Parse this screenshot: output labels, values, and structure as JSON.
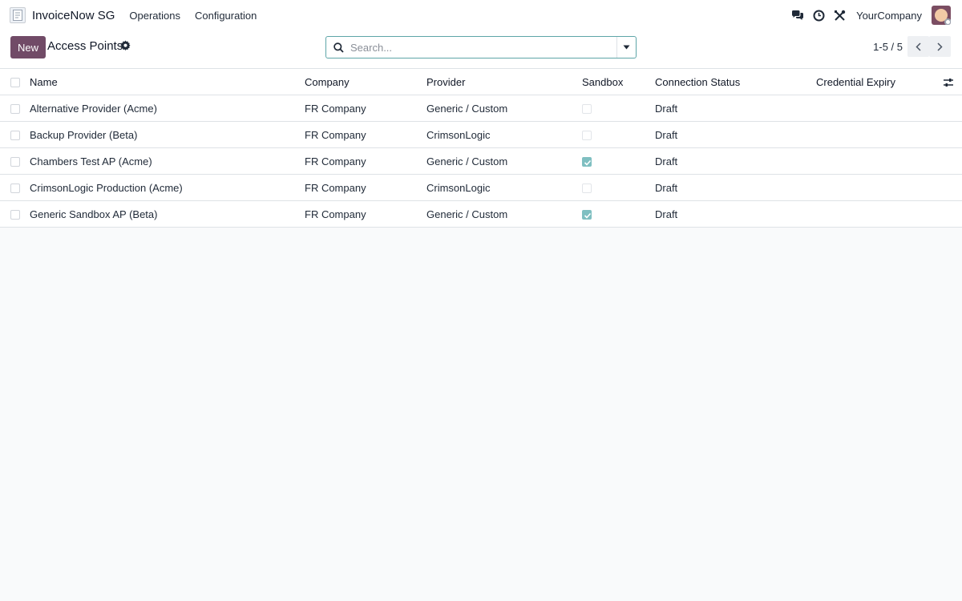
{
  "navbar": {
    "app_name": "InvoiceNow SG",
    "menus": [
      "Operations",
      "Configuration"
    ],
    "company": "YourCompany",
    "icons": [
      "chat-icon",
      "clock-icon",
      "tools-icon"
    ]
  },
  "control": {
    "new_label": "New",
    "title": "Access Points",
    "search_placeholder": "Search...",
    "pager": "1-5 / 5"
  },
  "table": {
    "columns": {
      "name": "Name",
      "company": "Company",
      "provider": "Provider",
      "sandbox": "Sandbox",
      "status": "Connection Status",
      "expiry": "Credential Expiry"
    },
    "rows": [
      {
        "name": "Alternative Provider (Acme)",
        "company": "FR Company",
        "provider": "Generic / Custom",
        "sandbox": false,
        "status": "Draft",
        "expiry": ""
      },
      {
        "name": "Backup Provider (Beta)",
        "company": "FR Company",
        "provider": "CrimsonLogic",
        "sandbox": false,
        "status": "Draft",
        "expiry": ""
      },
      {
        "name": "Chambers Test AP (Acme)",
        "company": "FR Company",
        "provider": "Generic / Custom",
        "sandbox": true,
        "status": "Draft",
        "expiry": ""
      },
      {
        "name": "CrimsonLogic Production (Acme)",
        "company": "FR Company",
        "provider": "CrimsonLogic",
        "sandbox": false,
        "status": "Draft",
        "expiry": ""
      },
      {
        "name": "Generic Sandbox AP (Beta)",
        "company": "FR Company",
        "provider": "Generic / Custom",
        "sandbox": true,
        "status": "Draft",
        "expiry": ""
      }
    ]
  },
  "colors": {
    "primary": "#714b67",
    "accent": "#7fbfc1",
    "search_border": "#5ea5a8"
  }
}
